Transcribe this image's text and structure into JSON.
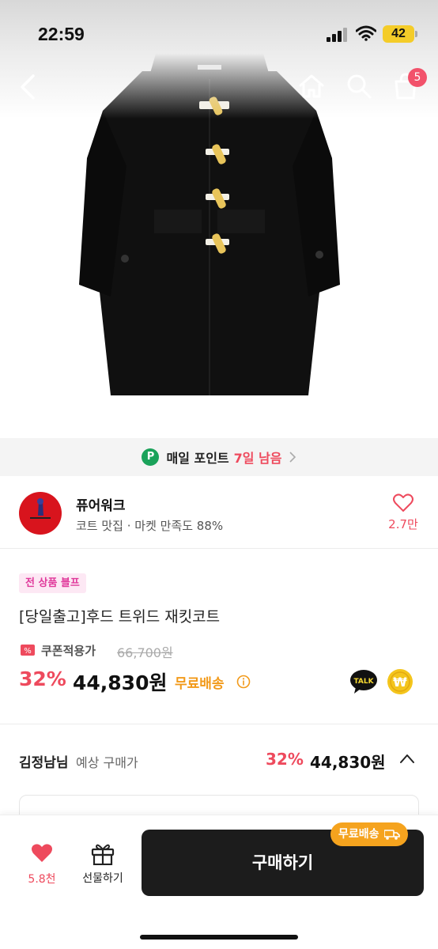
{
  "status": {
    "time": "22:59",
    "battery": "42"
  },
  "nav": {
    "cart_count": "5"
  },
  "points": {
    "badge": "P",
    "label": "매일 포인트",
    "days_left": "7일 남음"
  },
  "shop": {
    "name": "퓨어워크",
    "desc": "코트 맛집 · 마켓 만족도 88%",
    "likes": "2.7만"
  },
  "product": {
    "tag": "전 상품 블프",
    "title": "[당일출고]후드 트위드 재킷코트",
    "coupon_label": "쿠폰적용가",
    "original_price": "66,700원",
    "discount": "32%",
    "price": "44,830원",
    "shipping": "무료배송",
    "talk_badge": "TALK",
    "won_badge": "₩"
  },
  "estimate": {
    "name": "김정남님",
    "sub": "예상 구매가",
    "discount": "32%",
    "price": "44,830원"
  },
  "bottom": {
    "likes": "5.8천",
    "gift": "선물하기",
    "buy": "구매하기",
    "ship_chip": "무료배송"
  },
  "colors": {
    "accent": "#ee4a5d",
    "ship": "#f29a1a",
    "tag_bg": "#fde8f4",
    "buy_bg": "#1c1c1c"
  }
}
